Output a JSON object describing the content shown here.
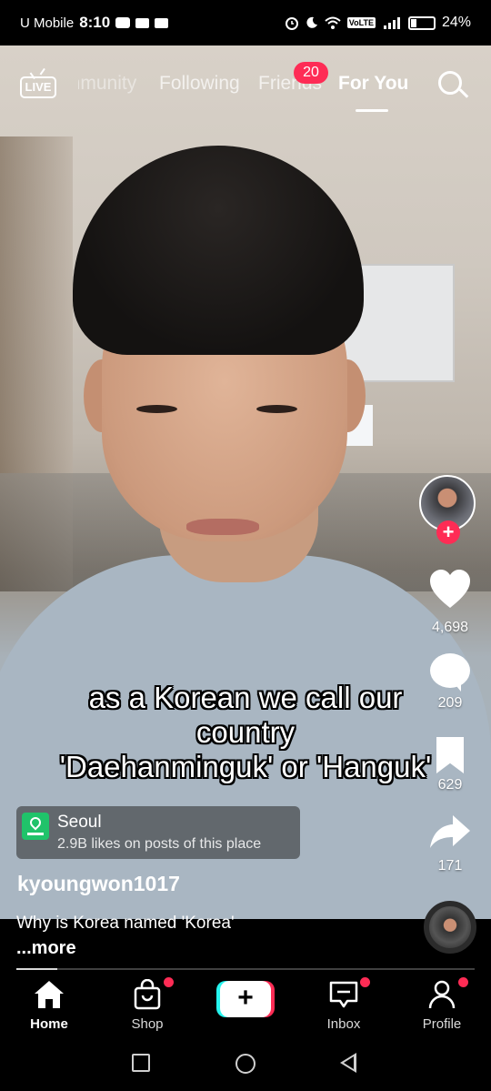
{
  "status_bar": {
    "carrier": "U Mobile",
    "time": "8:10",
    "battery_pct": "24%",
    "icons": [
      "youtube-icon",
      "mail-icon",
      "mail-icon",
      "alarm-icon",
      "moon-icon",
      "wifi-icon",
      "volte-icon",
      "signal-icon",
      "battery-icon"
    ]
  },
  "top_nav": {
    "live_label": "LIVE",
    "tabs": [
      {
        "label": "Community"
      },
      {
        "label": "Following"
      },
      {
        "label": "Friends",
        "badge": "20"
      },
      {
        "label": "For You",
        "active": true
      }
    ]
  },
  "actions": {
    "likes": "4,698",
    "comments": "209",
    "bookmarks": "629",
    "shares": "171"
  },
  "caption": {
    "line1": "as a Korean we call our",
    "line2": "country",
    "line3": "'Daehanminguk' or 'Hanguk'"
  },
  "location": {
    "name": "Seoul",
    "sub": "2.9B likes on posts of this place"
  },
  "post": {
    "username": "kyoungwon1017",
    "description": "Why is Korea named 'Korea'",
    "more": "...more",
    "progress": 0.09
  },
  "tab_bar": {
    "tabs": [
      {
        "label": "Home",
        "icon": "home-icon",
        "active": true
      },
      {
        "label": "Shop",
        "icon": "shopping-bag-icon",
        "dot": true
      },
      {
        "label": "",
        "icon": "create-plus-icon"
      },
      {
        "label": "Inbox",
        "icon": "inbox-icon",
        "dot": true
      },
      {
        "label": "Profile",
        "icon": "profile-icon",
        "dot": true
      }
    ]
  },
  "colors": {
    "accent_red": "#fe2c55",
    "accent_cyan": "#25f4ee",
    "location_green": "#20c36a"
  }
}
